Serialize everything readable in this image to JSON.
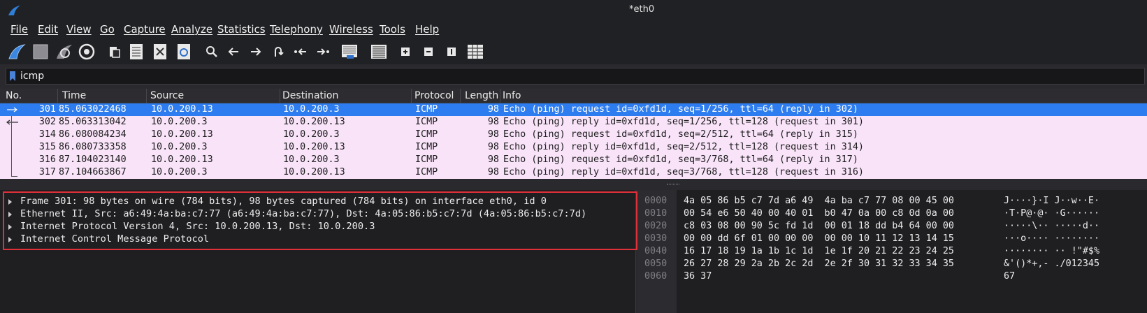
{
  "window": {
    "title": "*eth0"
  },
  "menu": [
    "File",
    "Edit",
    "View",
    "Go",
    "Capture",
    "Analyze",
    "Statistics",
    "Telephony",
    "Wireless",
    "Tools",
    "Help"
  ],
  "toolbar": {
    "icons": [
      "start-capture-icon",
      "stop-capture-icon",
      "restart-capture-icon",
      "capture-options-icon",
      "open-file-icon",
      "save-file-icon",
      "close-file-icon",
      "reload-file-icon",
      "find-packet-icon",
      "go-back-icon",
      "go-forward-icon",
      "go-to-packet-icon",
      "go-first-icon",
      "go-last-icon",
      "auto-scroll-icon",
      "colorize-icon",
      "zoom-in-icon",
      "zoom-out-icon",
      "normal-size-icon",
      "resize-columns-icon"
    ]
  },
  "filter": {
    "value": "icmp"
  },
  "columns": {
    "no": "No.",
    "time": "Time",
    "source": "Source",
    "destination": "Destination",
    "protocol": "Protocol",
    "length": "Length",
    "info": "Info"
  },
  "packets": [
    {
      "no": "301",
      "time": "85.063022468",
      "source": "10.0.200.13",
      "destination": "10.0.200.3",
      "protocol": "ICMP",
      "length": "98",
      "info": "Echo (ping) request  id=0xfd1d, seq=1/256, ttl=64 (reply in 302)"
    },
    {
      "no": "302",
      "time": "85.063313042",
      "source": "10.0.200.3",
      "destination": "10.0.200.13",
      "protocol": "ICMP",
      "length": "98",
      "info": "Echo (ping) reply    id=0xfd1d, seq=1/256, ttl=128 (request in 301)"
    },
    {
      "no": "314",
      "time": "86.080084234",
      "source": "10.0.200.13",
      "destination": "10.0.200.3",
      "protocol": "ICMP",
      "length": "98",
      "info": "Echo (ping) request  id=0xfd1d, seq=2/512, ttl=64 (reply in 315)"
    },
    {
      "no": "315",
      "time": "86.080733358",
      "source": "10.0.200.3",
      "destination": "10.0.200.13",
      "protocol": "ICMP",
      "length": "98",
      "info": "Echo (ping) reply    id=0xfd1d, seq=2/512, ttl=128 (request in 314)"
    },
    {
      "no": "316",
      "time": "87.104023140",
      "source": "10.0.200.13",
      "destination": "10.0.200.3",
      "protocol": "ICMP",
      "length": "98",
      "info": "Echo (ping) request  id=0xfd1d, seq=3/768, ttl=64 (reply in 317)"
    },
    {
      "no": "317",
      "time": "87.104663867",
      "source": "10.0.200.3",
      "destination": "10.0.200.13",
      "protocol": "ICMP",
      "length": "98",
      "info": "Echo (ping) reply    id=0xfd1d, seq=3/768, ttl=128 (request in 316)"
    }
  ],
  "details": [
    "Frame 301: 98 bytes on wire (784 bits), 98 bytes captured (784 bits) on interface eth0, id 0",
    "Ethernet II, Src: a6:49:4a:ba:c7:77 (a6:49:4a:ba:c7:77), Dst: 4a:05:86:b5:c7:7d (4a:05:86:b5:c7:7d)",
    "Internet Protocol Version 4, Src: 10.0.200.13, Dst: 10.0.200.3",
    "Internet Control Message Protocol"
  ],
  "hex": [
    {
      "offset": "0000",
      "bytes": "4a 05 86 b5 c7 7d a6 49  4a ba c7 77 08 00 45 00",
      "ascii": "J····}·I J··w··E·"
    },
    {
      "offset": "0010",
      "bytes": "00 54 e6 50 40 00 40 01  b0 47 0a 00 c8 0d 0a 00",
      "ascii": "·T·P@·@· ·G······"
    },
    {
      "offset": "0020",
      "bytes": "c8 03 08 00 90 5c fd 1d  00 01 18 dd b4 64 00 00",
      "ascii": "·····\\·· ·····d··"
    },
    {
      "offset": "0030",
      "bytes": "00 00 dd 6f 01 00 00 00  00 00 10 11 12 13 14 15",
      "ascii": "···o···· ········"
    },
    {
      "offset": "0040",
      "bytes": "16 17 18 19 1a 1b 1c 1d  1e 1f 20 21 22 23 24 25",
      "ascii": "········ ·· !\"#$%"
    },
    {
      "offset": "0050",
      "bytes": "26 27 28 29 2a 2b 2c 2d  2e 2f 30 31 32 33 34 35",
      "ascii": "&'()*+,- ./012345"
    },
    {
      "offset": "0060",
      "bytes": "36 37",
      "ascii": "67"
    }
  ],
  "colors": {
    "selected_row": "#2d7df0",
    "icmp_row": "#f8e3f8",
    "highlight_box": "#e0303a"
  }
}
